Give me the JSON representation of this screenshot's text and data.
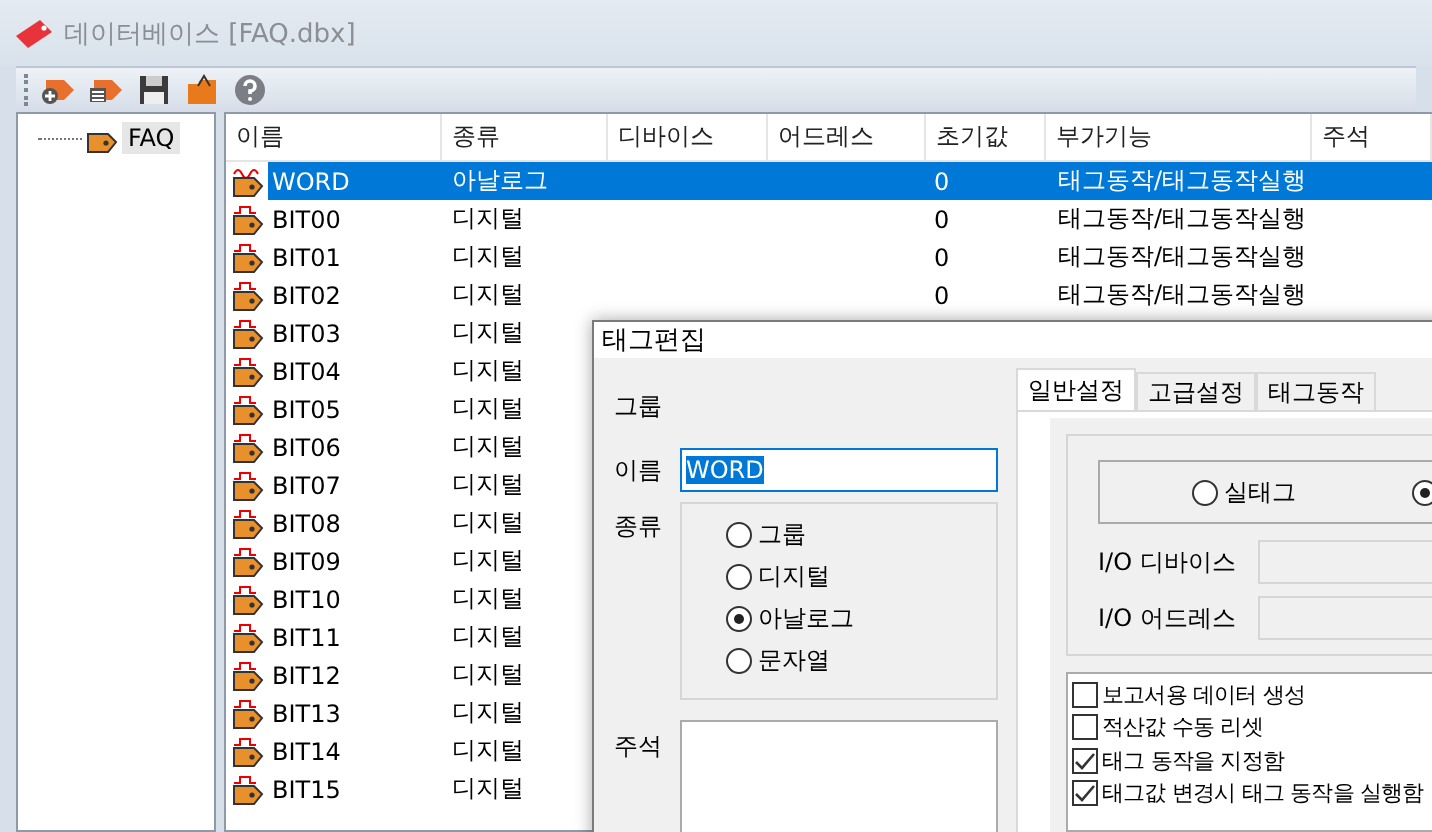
{
  "window": {
    "title": "데이터베이스 [FAQ.dbx]"
  },
  "tree": [
    {
      "label": "FAQ",
      "selected": true
    }
  ],
  "table": {
    "columns": [
      "이름",
      "종류",
      "디바이스",
      "어드레스",
      "초기값",
      "부가기능",
      "주석"
    ],
    "rows": [
      {
        "kind": "analog",
        "name": "WORD",
        "type": "아날로그",
        "initial": "0",
        "feature": "태그동작/태그동작실행",
        "selected": true
      },
      {
        "kind": "digital",
        "name": "BIT00",
        "type": "디지털",
        "initial": "0",
        "feature": "태그동작/태그동작실행",
        "selected": false
      },
      {
        "kind": "digital",
        "name": "BIT01",
        "type": "디지털",
        "initial": "0",
        "feature": "태그동작/태그동작실행",
        "selected": false
      },
      {
        "kind": "digital",
        "name": "BIT02",
        "type": "디지털",
        "initial": "0",
        "feature": "태그동작/태그동작실행",
        "selected": false
      },
      {
        "kind": "digital",
        "name": "BIT03",
        "type": "디지털",
        "selected": false
      },
      {
        "kind": "digital",
        "name": "BIT04",
        "type": "디지털",
        "selected": false
      },
      {
        "kind": "digital",
        "name": "BIT05",
        "type": "디지털",
        "selected": false
      },
      {
        "kind": "digital",
        "name": "BIT06",
        "type": "디지털",
        "selected": false
      },
      {
        "kind": "digital",
        "name": "BIT07",
        "type": "디지털",
        "selected": false
      },
      {
        "kind": "digital",
        "name": "BIT08",
        "type": "디지털",
        "selected": false
      },
      {
        "kind": "digital",
        "name": "BIT09",
        "type": "디지털",
        "selected": false
      },
      {
        "kind": "digital",
        "name": "BIT10",
        "type": "디지털",
        "selected": false
      },
      {
        "kind": "digital",
        "name": "BIT11",
        "type": "디지털",
        "selected": false
      },
      {
        "kind": "digital",
        "name": "BIT12",
        "type": "디지털",
        "selected": false
      },
      {
        "kind": "digital",
        "name": "BIT13",
        "type": "디지털",
        "selected": false
      },
      {
        "kind": "digital",
        "name": "BIT14",
        "type": "디지털",
        "selected": false
      },
      {
        "kind": "digital",
        "name": "BIT15",
        "type": "디지털",
        "selected": false
      }
    ]
  },
  "dialog": {
    "title": "태그편집",
    "group_label": "그룹",
    "name_label": "이름",
    "name_value": "WORD",
    "type_label": "종류",
    "type_options": [
      {
        "label": "그룹",
        "selected": false
      },
      {
        "label": "디지털",
        "selected": false
      },
      {
        "label": "아날로그",
        "selected": true
      },
      {
        "label": "문자열",
        "selected": false
      }
    ],
    "comment_label": "주석",
    "tabs": [
      {
        "label": "일반설정",
        "selected": true
      },
      {
        "label": "고급설정",
        "selected": false
      },
      {
        "label": "태그동작",
        "selected": false
      }
    ],
    "tag_mode_options": [
      {
        "label": "실태그",
        "selected": false
      },
      {
        "selected": true
      }
    ],
    "io_device_label": "I/O 디바이스",
    "io_address_label": "I/O 어드레스",
    "options": [
      {
        "label": "보고서용 데이터 생성",
        "checked": false
      },
      {
        "label": "적산값 수동 리셋",
        "checked": false
      },
      {
        "label": "태그 동작을 지정함",
        "checked": true
      },
      {
        "label": "태그값 변경시 태그 동작을 실행함",
        "checked": true
      }
    ]
  }
}
